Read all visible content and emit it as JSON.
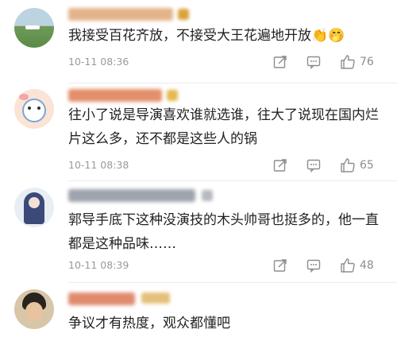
{
  "comments": [
    {
      "text": "我接受百花齐放，不接受大王花遍地开放",
      "emoji": "👏🤭",
      "time": "10-11 08:36",
      "likes": "76"
    },
    {
      "text": "往小了说是导演喜欢谁就选谁，往大了说现在国内烂片这么多，还不都是这些人的锅",
      "time": "10-11 08:38",
      "likes": "65"
    },
    {
      "text": "郭导手底下这种没演技的木头帅哥也挺多的，他一直都是这种品味……",
      "time": "10-11 08:39",
      "likes": "48"
    },
    {
      "text": "争议才有热度，观众都懂吧"
    }
  ],
  "icons": {
    "share": "share-icon",
    "comment": "comment-icon",
    "like": "thumbs-up-icon"
  },
  "colors": {
    "text": "#222222",
    "meta": "#9a9a9a",
    "divider": "#ececec"
  }
}
